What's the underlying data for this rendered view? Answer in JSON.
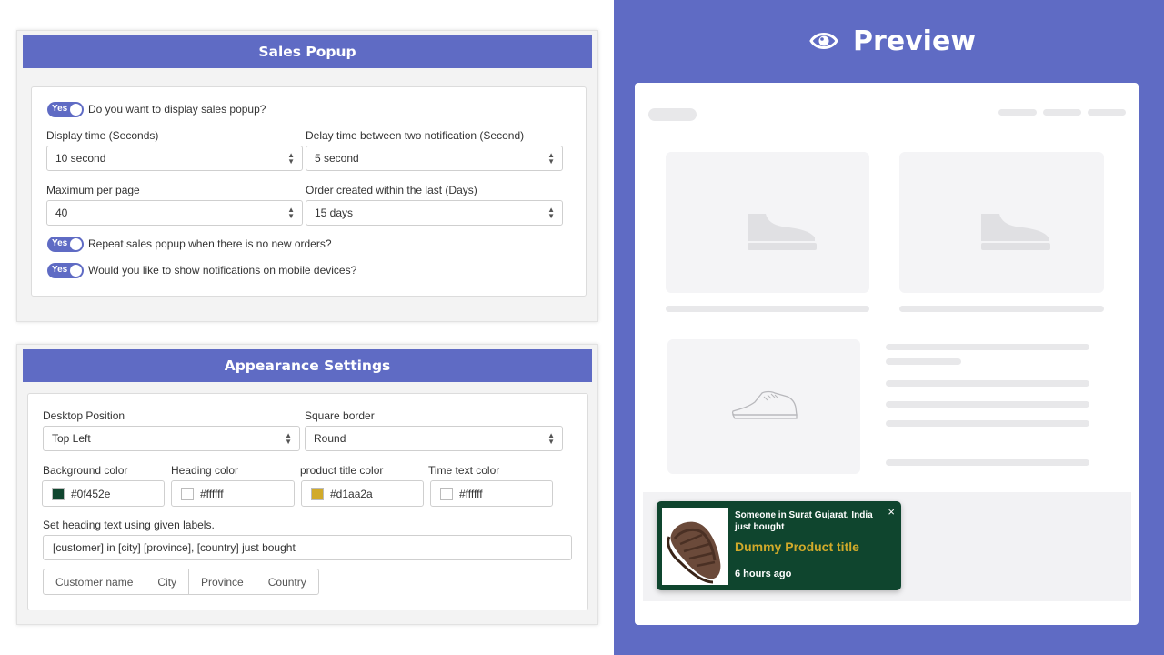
{
  "sales_popup": {
    "title": "Sales Popup",
    "display_popup": {
      "toggle": "Yes",
      "label": "Do you want to display sales popup?"
    },
    "display_time": {
      "label": "Display time (Seconds)",
      "value": "10 second"
    },
    "delay_time": {
      "label": "Delay time between two notification (Second)",
      "value": "5 second"
    },
    "max_per_page": {
      "label": "Maximum per page",
      "value": "40"
    },
    "order_created": {
      "label": "Order created within the last (Days)",
      "value": "15 days"
    },
    "repeat_popup": {
      "toggle": "Yes",
      "label": "Repeat sales popup when there is no new orders?"
    },
    "mobile_notifications": {
      "toggle": "Yes",
      "label": "Would you like to show notifications on mobile devices?"
    }
  },
  "appearance": {
    "title": "Appearance Settings",
    "desktop_position": {
      "label": "Desktop Position",
      "value": "Top Left"
    },
    "square_border": {
      "label": "Square border",
      "value": "Round"
    },
    "background_color": {
      "label": "Background color",
      "value": "#0f452e"
    },
    "heading_color": {
      "label": "Heading color",
      "value": "#ffffff"
    },
    "product_title_color": {
      "label": "product title color",
      "value": "#d1aa2a"
    },
    "time_text_color": {
      "label": "Time text color",
      "value": "#ffffff"
    },
    "heading_text": {
      "label": "Set heading text using given labels.",
      "value": "[customer] in [city] [province], [country] just bought"
    },
    "tags": [
      "Customer name",
      "City",
      "Province",
      "Country"
    ]
  },
  "preview": {
    "title": "Preview",
    "icon": "eye-icon",
    "popup": {
      "heading": "Someone in Surat Gujarat, India just bought",
      "product_title": "Dummy Product title",
      "time": "6 hours ago",
      "close": "×",
      "product_image": "sandal-image"
    },
    "placeholder_icons": [
      "shoe-icon",
      "shoe-icon",
      "sneaker-outline-icon"
    ]
  },
  "colors": {
    "accent": "#5f6bc4",
    "popup_background": "#0f452e",
    "popup_product_title": "#d1aa2a"
  }
}
